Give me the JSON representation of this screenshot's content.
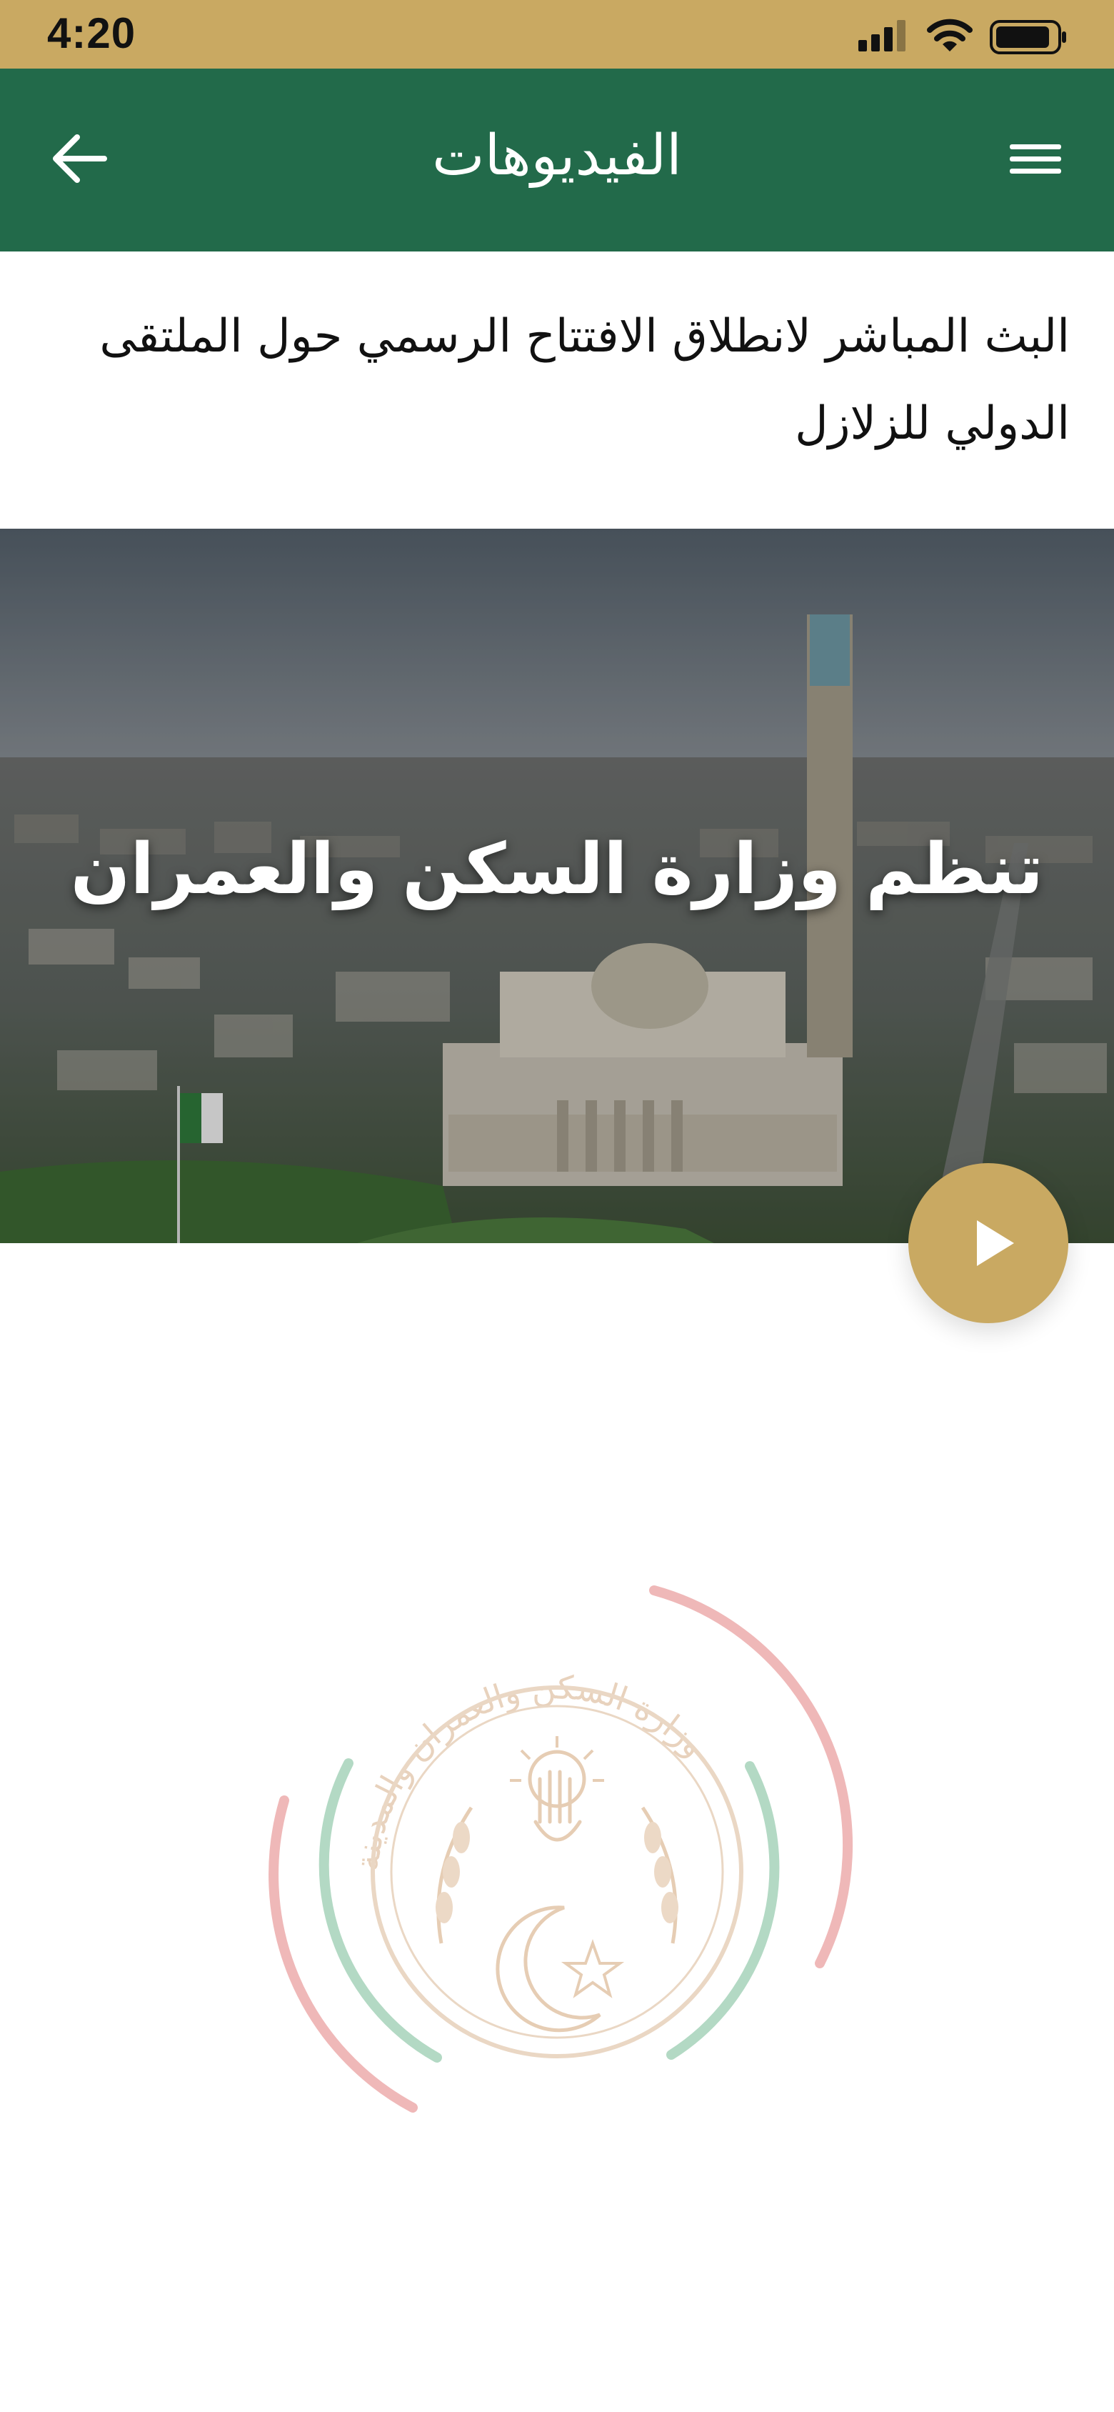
{
  "status_bar": {
    "time": "4:20",
    "icons": [
      "signal-icon",
      "wifi-icon",
      "battery-icon"
    ]
  },
  "header": {
    "title": "الفيديوهات",
    "back_icon": "arrow-left-icon",
    "menu_icon": "hamburger-menu-icon"
  },
  "video": {
    "title": "البث المباشر لانطلاق الافتتاح الرسمي حول الملتقى الدولي للزلازل",
    "overlay_text": "تنظم وزارة السكن والعمران",
    "play_icon": "play-icon"
  },
  "footer_logo": {
    "ring_text": "وزارة السكن والعمران والمدينة"
  },
  "colors": {
    "status_bar": "#c9a962",
    "app_bar": "#226a4a",
    "accent_gold": "#c9a962",
    "logo_red": "#e58c8c",
    "logo_green": "#8dc4a7",
    "logo_tan": "#e2c6a6"
  }
}
